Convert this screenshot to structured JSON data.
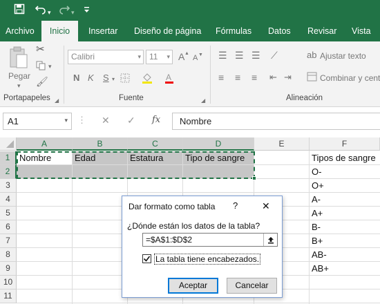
{
  "quick_access": {
    "save_icon": "save-icon",
    "undo_icon": "undo-icon",
    "redo_icon": "redo-icon",
    "customize_icon": "customize-qat-icon"
  },
  "ribbon_tabs": [
    "Archivo",
    "Inicio",
    "Insertar",
    "Diseño de página",
    "Fórmulas",
    "Datos",
    "Revisar",
    "Vista"
  ],
  "active_tab": "Inicio",
  "ribbon": {
    "clipboard": {
      "paste_label": "Pegar",
      "group_label": "Portapapeles"
    },
    "font": {
      "font_name": "Calibri",
      "font_size": "11",
      "bold": "N",
      "italic": "K",
      "underline": "S",
      "grow": "A",
      "shrink": "A",
      "group_label": "Fuente"
    },
    "alignment": {
      "wrap_text": "Ajustar texto",
      "merge_center": "Combinar y cent",
      "group_label": "Alineación"
    }
  },
  "formula_bar": {
    "name_box": "A1",
    "fx": "fx",
    "cancel": "✕",
    "enter": "✓",
    "content": "Nombre"
  },
  "columns": [
    "A",
    "B",
    "C",
    "D",
    "E",
    "F"
  ],
  "rows": [
    "1",
    "2",
    "3",
    "4",
    "5",
    "6",
    "7",
    "8",
    "9",
    "10",
    "11"
  ],
  "cells": {
    "A1": "Nombre",
    "B1": "Edad",
    "C1": "Estatura",
    "D1": "Tipo de sangre",
    "F1": "Tipos de sangre",
    "F2": "O-",
    "F3": "O+",
    "F4": "A-",
    "F5": "A+",
    "F6": "B-",
    "F7": "B+",
    "F8": "AB-",
    "F9": "AB+"
  },
  "dialog": {
    "title": "Dar formato como tabla",
    "help": "?",
    "close": "✕",
    "question": "¿Dónde están los datos de la tabla?",
    "range_value": "=$A$1:$D$2",
    "collapse_icon": "collapse-dialog-icon",
    "checkbox_label": "La tabla tiene encabezados.",
    "checkbox_checked": true,
    "ok": "Aceptar",
    "cancel": "Cancelar"
  },
  "colors": {
    "excel_green": "#217346",
    "selection_fill": "#c6c6c6",
    "selection_border": "#217346"
  }
}
